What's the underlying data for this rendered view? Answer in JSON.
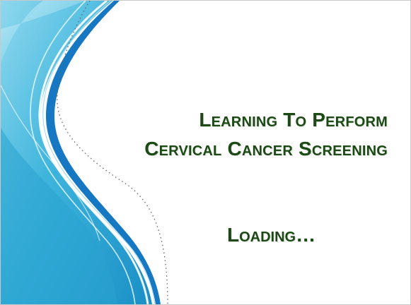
{
  "slide": {
    "title_lines": [
      "Learning To Perform",
      "Cervical Cancer Screening"
    ],
    "status_text": "Loading…"
  },
  "colors": {
    "title_text": "#1b4a14",
    "wave_light": "#6fcbe6",
    "wave_mid": "#2ea9d2",
    "wave_deep": "#1678c2",
    "background": "#ffffff"
  }
}
